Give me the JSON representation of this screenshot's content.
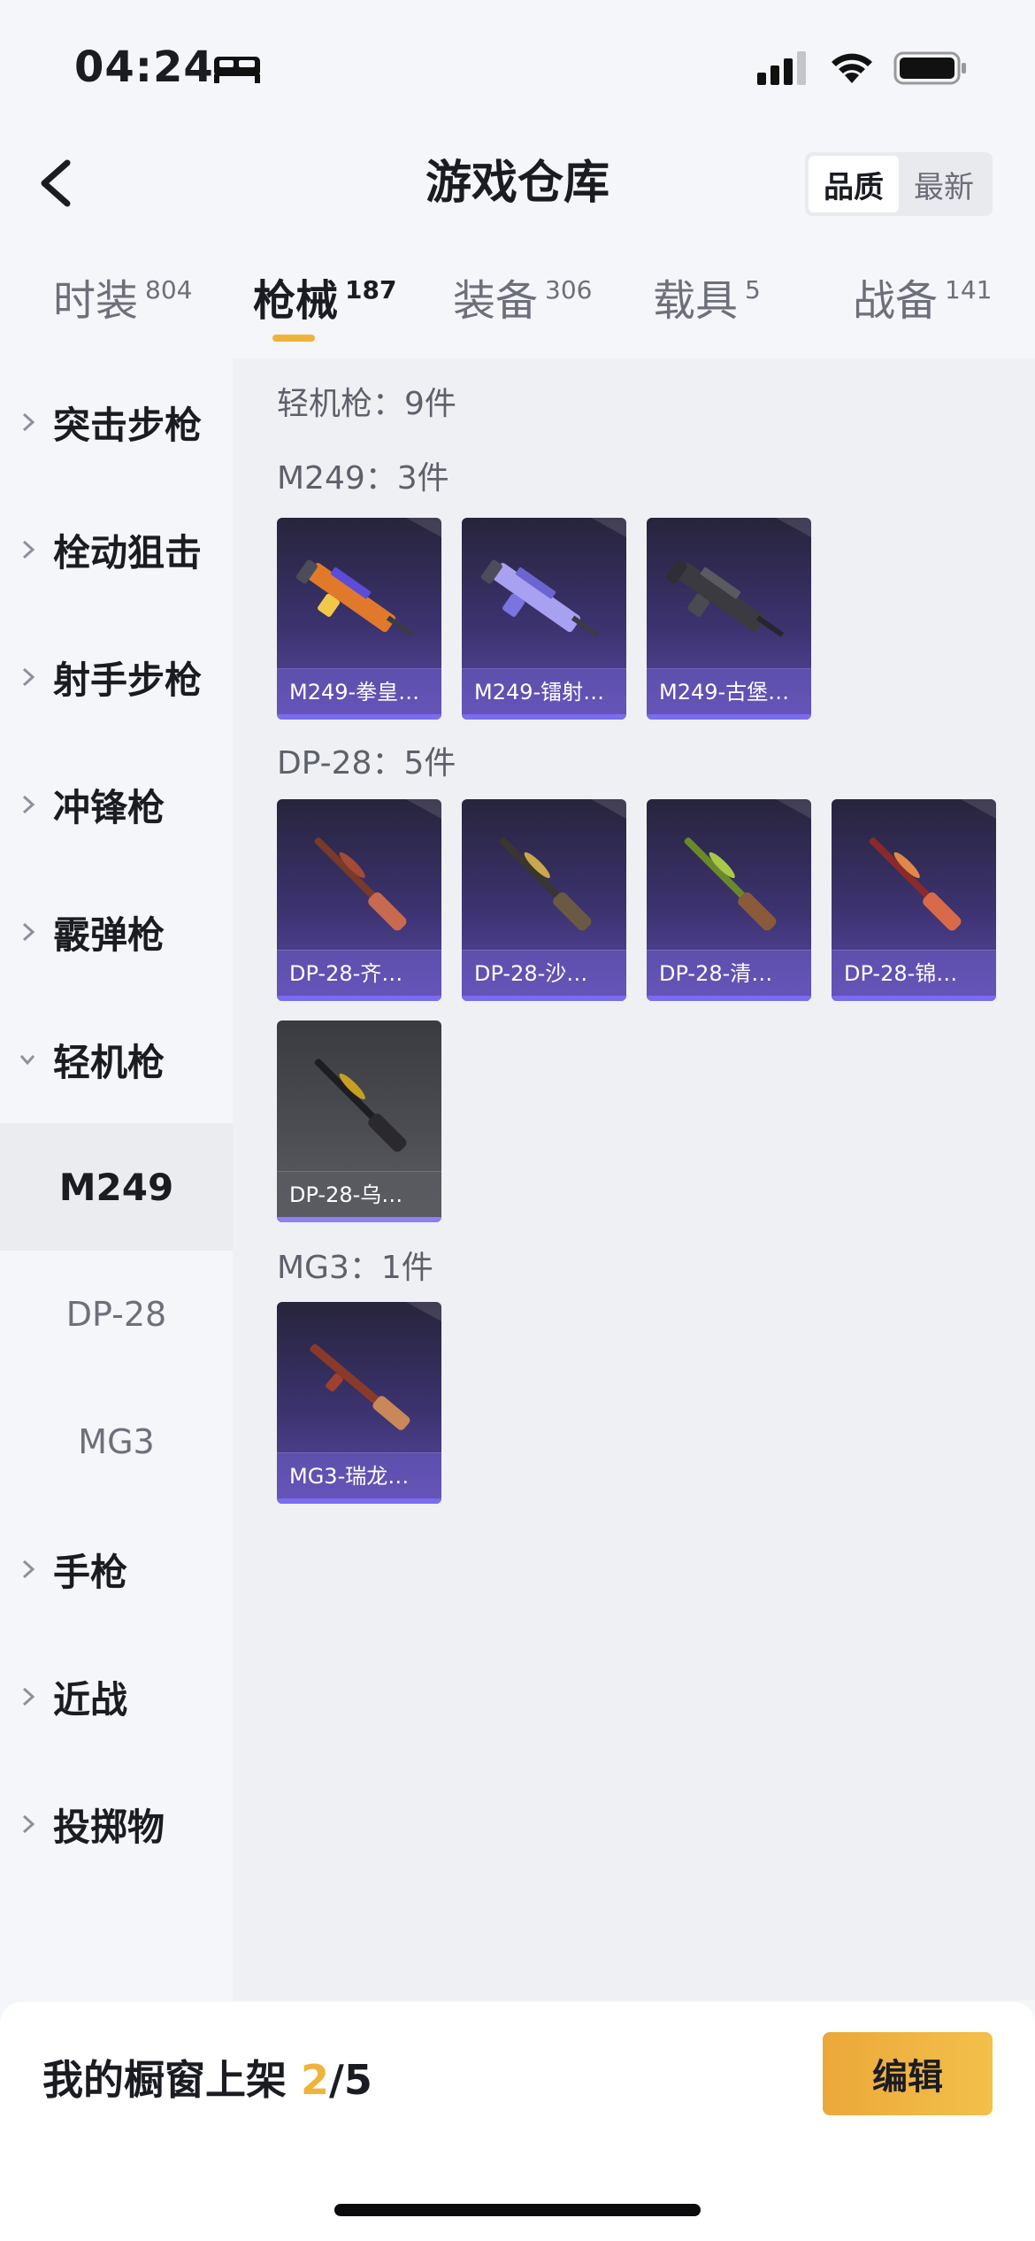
{
  "status": {
    "time": "04:24"
  },
  "header": {
    "title": "游戏仓库",
    "sort_options": [
      "品质",
      "最新"
    ],
    "sort_active": "品质"
  },
  "tabs": [
    {
      "label": "时装",
      "count": "804"
    },
    {
      "label": "枪械",
      "count": "187",
      "active": true
    },
    {
      "label": "装备",
      "count": "306"
    },
    {
      "label": "载具",
      "count": "5"
    },
    {
      "label": "战备",
      "count": "141"
    }
  ],
  "sidebar": {
    "items": [
      {
        "label": "突击步枪"
      },
      {
        "label": "栓动狙击"
      },
      {
        "label": "射手步枪"
      },
      {
        "label": "冲锋枪"
      },
      {
        "label": "霰弹枪"
      },
      {
        "label": "轻机枪",
        "expanded": true
      }
    ],
    "sub_items": [
      {
        "label": "M249",
        "active": true
      },
      {
        "label": "DP-28"
      },
      {
        "label": "MG3"
      }
    ],
    "items_after": [
      {
        "label": "手枪"
      },
      {
        "label": "近战"
      },
      {
        "label": "投掷物"
      }
    ]
  },
  "content": {
    "category_title": "轻机枪：9件",
    "groups": [
      {
        "title": "M249：3件",
        "items": [
          "M249-拳皇…",
          "M249-镭射…",
          "M249-古堡…"
        ]
      },
      {
        "title": "DP-28：5件",
        "items": [
          "DP-28-齐…",
          "DP-28-沙…",
          "DP-28-清…",
          "DP-28-锦…",
          "DP-28-乌…"
        ]
      },
      {
        "title": "MG3：1件",
        "items": [
          "MG3-瑞龙…"
        ]
      }
    ]
  },
  "bottom": {
    "showcase_prefix": "我的橱窗上架 ",
    "showcase_count": "2",
    "showcase_total": "/5",
    "edit_label": "编辑"
  },
  "colors": {
    "accent": "#f0b33a",
    "card_purple": "#5c4aa8",
    "card_bar": "#7a6cf0"
  }
}
